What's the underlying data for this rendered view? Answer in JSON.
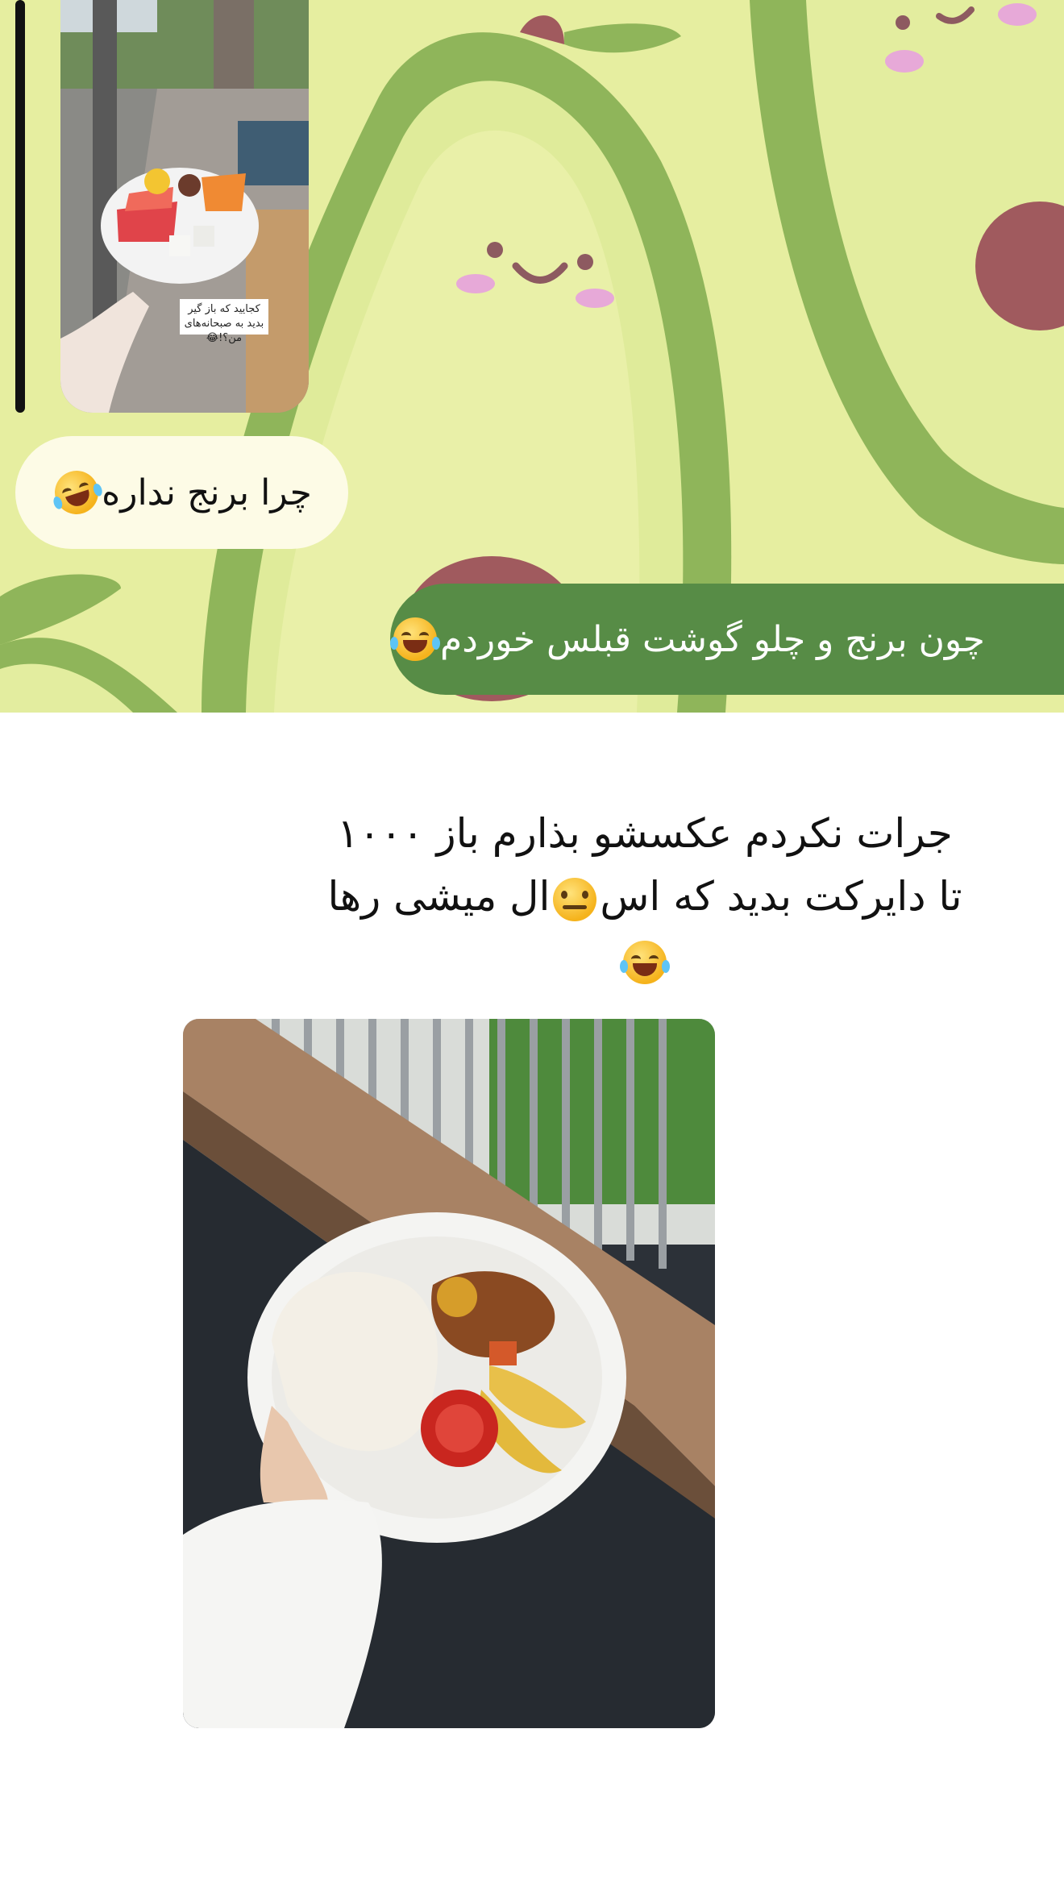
{
  "chat": {
    "story_sticker_text": "کجایید که باز گیر بدید به صبحانه‌های من؟!😂",
    "incoming_message": "چرا برنج نداره",
    "outgoing_message": "چون برنج و چلو گوشت قبلس خوردم"
  },
  "caption": {
    "line1": "جرات نکردم عکسشو بذارم باز ۱۰۰۰",
    "line2_part1": "تا دایرکت بدید که اس",
    "line2_part2": "ال میشی رها"
  },
  "icons": {
    "incoming_emoji": "rolling-on-floor-laughing-emoji",
    "outgoing_emoji": "tears-of-joy-emoji",
    "caption_inline_emoji": "neutral-face-emoji",
    "caption_end_emoji": "tears-of-joy-emoji"
  },
  "colors": {
    "wallpaper_bg": "#e6eea0",
    "outgoing_bubble": "#578c46",
    "incoming_bubble": "#fdfbe6"
  }
}
